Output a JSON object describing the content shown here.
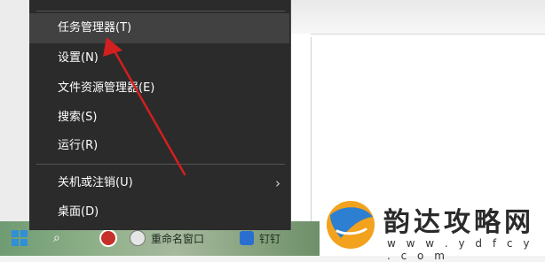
{
  "context_menu": {
    "items": [
      {
        "label": "任务管理器(T)",
        "highlighted": true
      },
      {
        "label": "设置(N)"
      },
      {
        "label": "文件资源管理器(E)"
      },
      {
        "label": "搜索(S)"
      },
      {
        "label": "运行(R)"
      },
      {
        "label": "关机或注销(U)",
        "has_submenu": true
      },
      {
        "label": "桌面(D)"
      }
    ]
  },
  "taskbar": {
    "search_icon": "search-icon",
    "app2_label": "重命名窗口",
    "app3_label": "钉钉"
  },
  "watermark": {
    "title": "韵达攻略网",
    "url": "w w w . y d f c y . c o m"
  },
  "colors": {
    "menu_bg": "#2b2b2b",
    "menu_highlight": "#414141",
    "arrow": "#d21f1f"
  }
}
